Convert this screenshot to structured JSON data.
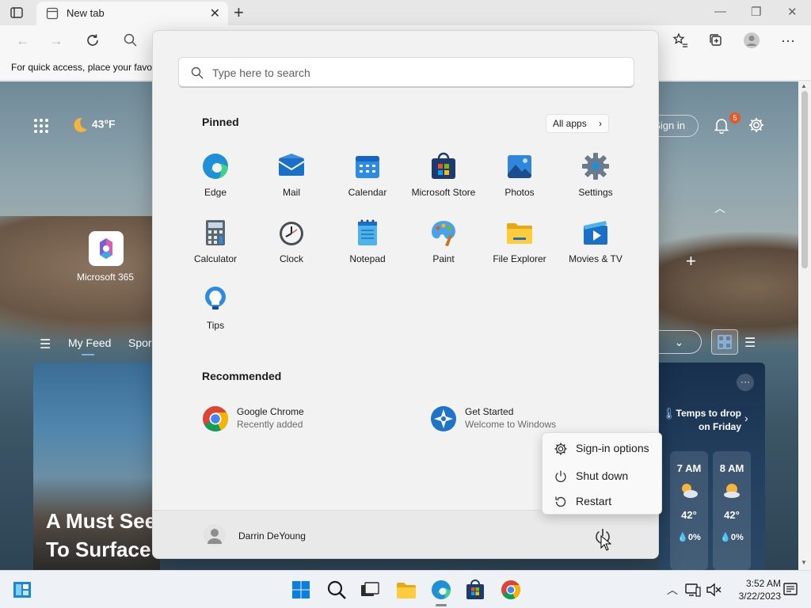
{
  "browser": {
    "tab_title": "New tab",
    "tab_close": "✕",
    "new_tab": "+",
    "window_controls": {
      "minimize": "—",
      "restore": "❐",
      "close": "✕"
    },
    "favorites_bar_text": "For quick access, place your favo"
  },
  "ntp": {
    "weather_temp": "43°F",
    "sign_in": "Sign in",
    "notification_count": "5",
    "microsoft365_label": "Microsoft 365",
    "feed_tabs": {
      "my_feed": "My Feed",
      "sports": "Spor"
    },
    "hero_headline_line1": "A Must See",
    "hero_headline_line2": "To Surface",
    "weather_card": {
      "title_line1": "Temps to drop",
      "title_line2": "on Friday",
      "more": "···",
      "hours": [
        {
          "time": "7 AM",
          "temp": "42°",
          "precip": "0%"
        },
        {
          "time": "8 AM",
          "temp": "42°",
          "precip": "0%"
        }
      ]
    }
  },
  "start_menu": {
    "search_placeholder": "Type here to search",
    "pinned_title": "Pinned",
    "all_apps": "All apps",
    "pinned": [
      {
        "label": "Edge",
        "icon": "edge-icon"
      },
      {
        "label": "Mail",
        "icon": "mail-icon"
      },
      {
        "label": "Calendar",
        "icon": "calendar-icon"
      },
      {
        "label": "Microsoft Store",
        "icon": "store-icon"
      },
      {
        "label": "Photos",
        "icon": "photos-icon"
      },
      {
        "label": "Settings",
        "icon": "settings-icon"
      },
      {
        "label": "Calculator",
        "icon": "calculator-icon"
      },
      {
        "label": "Clock",
        "icon": "clock-icon"
      },
      {
        "label": "Notepad",
        "icon": "notepad-icon"
      },
      {
        "label": "Paint",
        "icon": "paint-icon"
      },
      {
        "label": "File Explorer",
        "icon": "folder-icon"
      },
      {
        "label": "Movies & TV",
        "icon": "movies-icon"
      },
      {
        "label": "Tips",
        "icon": "tips-icon"
      }
    ],
    "recommended_title": "Recommended",
    "recommended": [
      {
        "name": "Google Chrome",
        "sub": "Recently added",
        "icon": "chrome-icon"
      },
      {
        "name": "Get Started",
        "sub": "Welcome to Windows",
        "icon": "get-started-icon"
      }
    ],
    "user_name": "Darrin DeYoung"
  },
  "power_menu": {
    "sign_in_options": "Sign-in options",
    "shut_down": "Shut down",
    "restart": "Restart"
  },
  "taskbar": {
    "time": "3:52 AM",
    "date": "3/22/2023"
  },
  "colors": {
    "accent": "#0078d4",
    "badge": "#e05a2a"
  }
}
